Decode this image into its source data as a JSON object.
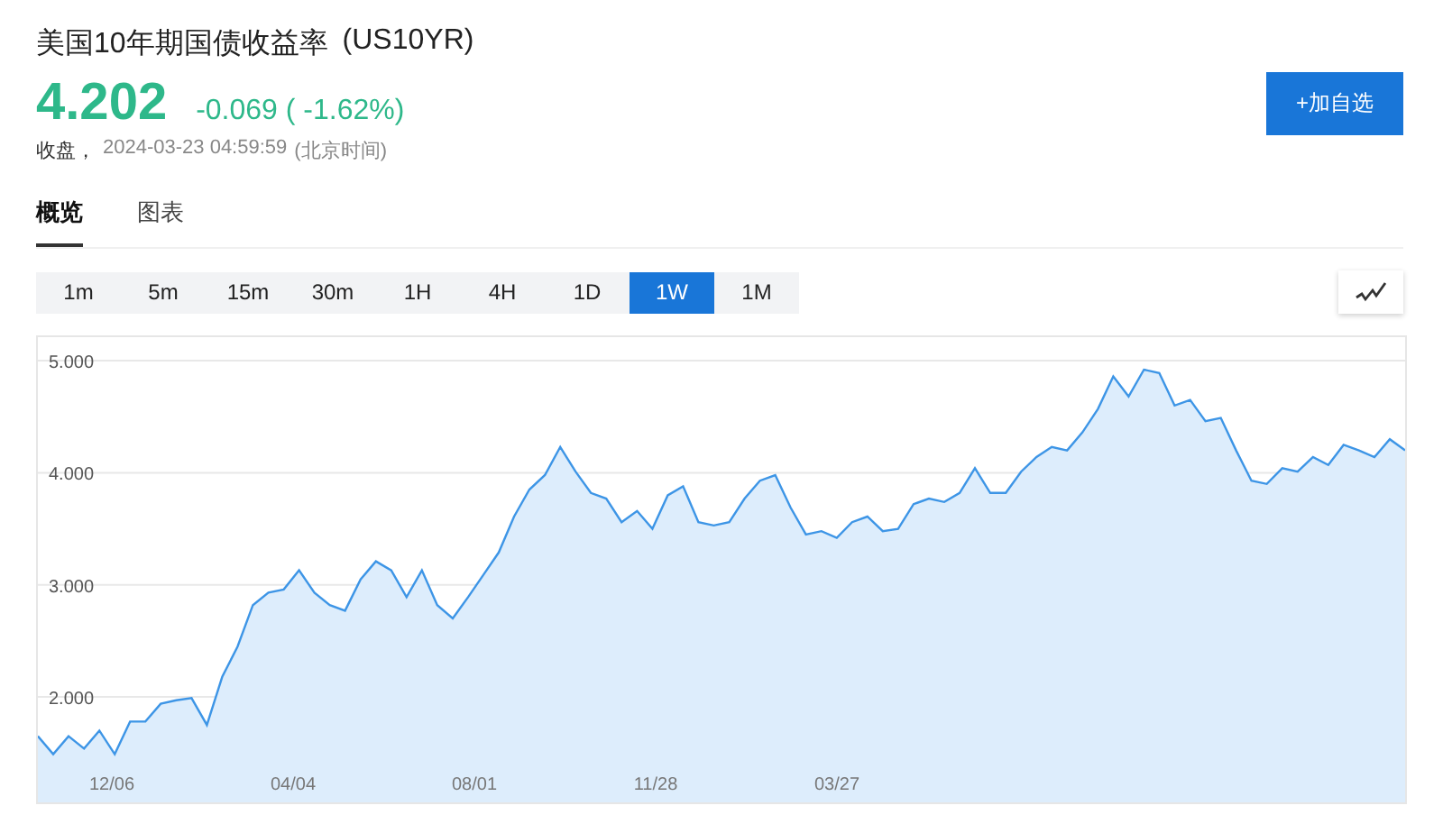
{
  "header": {
    "title": "美国10年期国债收益率",
    "symbol": "(US10YR)",
    "price": "4.202",
    "change": "-0.069 ( -1.62%)",
    "close_label": "收盘，",
    "timestamp": "2024-03-23 04:59:59",
    "timezone": "(北京时间)",
    "add_button": "+加自选"
  },
  "tabs": [
    {
      "label": "概览",
      "selected": true
    },
    {
      "label": "图表",
      "selected": false
    }
  ],
  "intervals": [
    {
      "label": "1m",
      "selected": false
    },
    {
      "label": "5m",
      "selected": false
    },
    {
      "label": "15m",
      "selected": false
    },
    {
      "label": "30m",
      "selected": false
    },
    {
      "label": "1H",
      "selected": false
    },
    {
      "label": "4H",
      "selected": false
    },
    {
      "label": "1D",
      "selected": false
    },
    {
      "label": "1W",
      "selected": true
    },
    {
      "label": "1M",
      "selected": false
    }
  ],
  "chart": {
    "chart_data": {
      "type": "area",
      "ylim": [
        1.06,
        5.21
      ],
      "yticks": [
        {
          "value": 2,
          "label": "2.000"
        },
        {
          "value": 3,
          "label": "3.000"
        },
        {
          "value": 4,
          "label": "4.000"
        },
        {
          "value": 5,
          "label": "5.000"
        }
      ],
      "grid": true,
      "series": [
        {
          "color": "#3d95e6",
          "values": [
            1.65,
            1.49,
            1.65,
            1.54,
            1.7,
            1.49,
            1.78,
            1.78,
            1.94,
            1.97,
            1.99,
            1.75,
            2.18,
            2.45,
            2.82,
            2.93,
            2.96,
            3.13,
            2.93,
            2.82,
            2.77,
            3.05,
            3.21,
            3.13,
            2.89,
            3.13,
            2.82,
            2.7,
            2.89,
            3.09,
            3.29,
            3.61,
            3.85,
            3.98,
            4.23,
            4.01,
            3.82,
            3.77,
            3.56,
            3.66,
            3.5,
            3.8,
            3.88,
            3.56,
            3.53,
            3.56,
            3.77,
            3.93,
            3.98,
            3.69,
            3.45,
            3.48,
            3.42,
            3.56,
            3.61,
            3.48,
            3.5,
            3.72,
            3.77,
            3.74,
            3.82,
            4.04,
            3.82,
            3.82,
            4.01,
            4.14,
            4.23,
            4.2,
            4.36,
            4.57,
            4.86,
            4.68,
            4.92,
            4.89,
            4.6,
            4.65,
            4.46,
            4.49,
            4.2,
            3.93,
            3.9,
            4.04,
            4.01,
            4.14,
            4.07,
            4.25,
            4.2,
            4.14,
            4.3,
            4.2
          ]
        }
      ]
    },
    "x_labels": [
      "12/06",
      "04/04",
      "08/01",
      "11/28",
      "03/27"
    ]
  }
}
